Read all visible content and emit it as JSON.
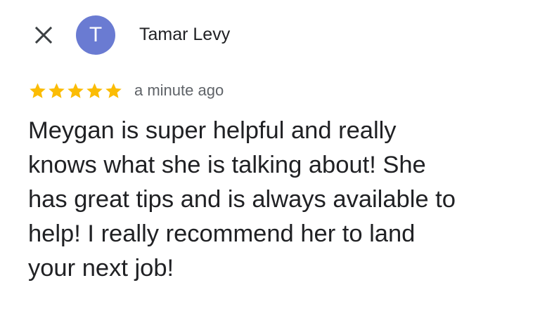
{
  "header": {
    "close_icon": "close-icon",
    "avatar": {
      "initial": "T",
      "color": "#6a7bd2"
    },
    "reviewer_name": "Tamar Levy"
  },
  "rating": {
    "stars": 5,
    "max_stars": 5,
    "star_color": "#fbbc04",
    "timestamp": "a minute ago"
  },
  "review": {
    "text": "Meygan is super helpful and really\nknows what she is talking about! She\nhas great tips and is always available to\nhelp! I really recommend her to land\nyour next job!"
  }
}
